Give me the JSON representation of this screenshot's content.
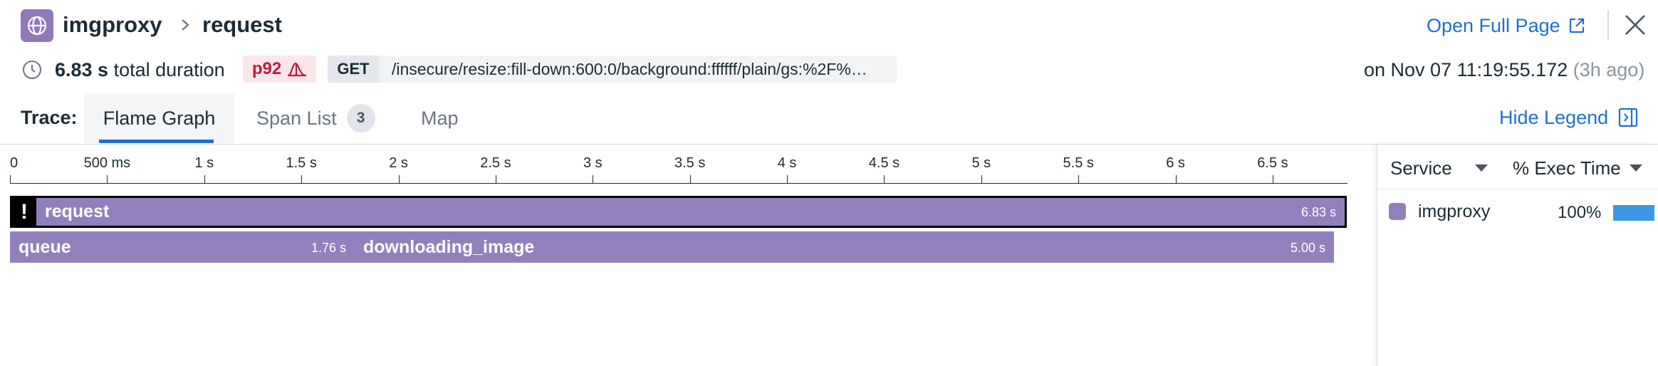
{
  "header": {
    "service_name": "imgproxy",
    "span_name": "request",
    "open_full_page": "Open Full Page"
  },
  "meta": {
    "duration_value": "6.83 s",
    "duration_suffix": "total duration",
    "percentile": "p92",
    "method": "GET",
    "url": "/insecure/resize:fill-down:600:0/background:ffffff/plain/gs:%2F%…",
    "timestamp": "on Nov 07 11:19:55.172",
    "relative_time": "(3h ago)"
  },
  "tabs": {
    "trace_label": "Trace:",
    "flame_graph": "Flame Graph",
    "span_list": "Span List",
    "span_count": "3",
    "map": "Map",
    "hide_legend": "Hide Legend"
  },
  "flame": {
    "axis_max_s": 6.83,
    "ticks": [
      {
        "label": "0",
        "value": 0
      },
      {
        "label": "500 ms",
        "value": 0.5
      },
      {
        "label": "1 s",
        "value": 1.0
      },
      {
        "label": "1.5 s",
        "value": 1.5
      },
      {
        "label": "2 s",
        "value": 2.0
      },
      {
        "label": "2.5 s",
        "value": 2.5
      },
      {
        "label": "3 s",
        "value": 3.0
      },
      {
        "label": "3.5 s",
        "value": 3.5
      },
      {
        "label": "4 s",
        "value": 4.0
      },
      {
        "label": "4.5 s",
        "value": 4.5
      },
      {
        "label": "5 s",
        "value": 5.0
      },
      {
        "label": "5.5 s",
        "value": 5.5
      },
      {
        "label": "6 s",
        "value": 6.0
      },
      {
        "label": "6.5 s",
        "value": 6.5
      }
    ],
    "spans": {
      "request": {
        "name": "request",
        "duration": "6.83 s",
        "error_mark": "!"
      },
      "queue": {
        "name": "queue",
        "duration": "1.76 s"
      },
      "downloading_image": {
        "name": "downloading_image",
        "duration": "5.00 s"
      }
    }
  },
  "legend": {
    "service_header": "Service",
    "exec_header": "% Exec Time",
    "rows": [
      {
        "service": "imgproxy",
        "percent": "100%",
        "percent_value": 100,
        "color": "#9280bc"
      }
    ],
    "bar_color": "#3d96e6"
  },
  "colors": {
    "accent": "#1f6fd1",
    "service": "#9280bc",
    "p92_text": "#c21b3a"
  }
}
